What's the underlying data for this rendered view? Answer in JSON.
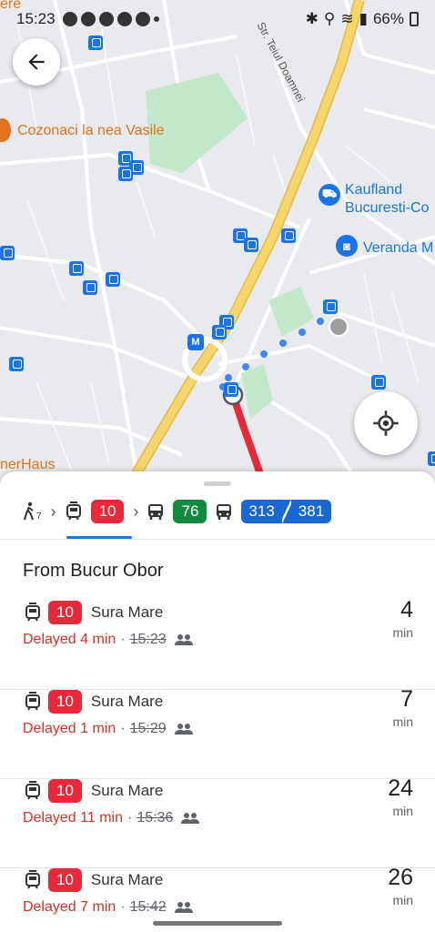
{
  "status_bar": {
    "time": "15:23",
    "battery": "66%"
  },
  "map": {
    "labels": {
      "top_left_fragment": "ere",
      "street": "Str. Teiul Doamnei",
      "poi_cozonaci": "Cozonaci la nea Vasile",
      "poi_kaufland_1": "Kaufland",
      "poi_kaufland_2": "Bucuresti-Co",
      "poi_veranda": "Veranda M",
      "bottom_left_fragment": "nerHaus",
      "metro": "M"
    },
    "colors": {
      "route_red": "#e8293a",
      "walk_blue": "#4285f4",
      "highway": "#f5d66b",
      "park": "#b9e4c1"
    }
  },
  "route_summary": {
    "walk_minutes": "7",
    "tram_line": "10",
    "bus_line_1": "76",
    "bus_line_2a": "313",
    "bus_line_2b": "381"
  },
  "section_title": "From Bucur Obor",
  "departures": [
    {
      "line": "10",
      "destination": "Sura Mare",
      "delay": "Delayed 4 min",
      "separator": "·",
      "scheduled": "15:23",
      "minutes": "4",
      "unit": "min"
    },
    {
      "line": "10",
      "destination": "Sura Mare",
      "delay": "Delayed 1 min",
      "separator": "·",
      "scheduled": "15:29",
      "minutes": "7",
      "unit": "min"
    },
    {
      "line": "10",
      "destination": "Sura Mare",
      "delay": "Delayed 11 min",
      "separator": "·",
      "scheduled": "15:36",
      "minutes": "24",
      "unit": "min"
    },
    {
      "line": "10",
      "destination": "Sura Mare",
      "delay": "Delayed 7 min",
      "separator": "·",
      "scheduled": "15:42",
      "minutes": "26",
      "unit": "min"
    }
  ]
}
